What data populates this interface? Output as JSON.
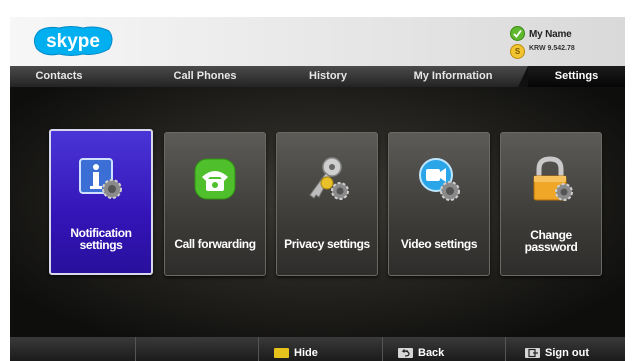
{
  "app": {
    "logo_text": "skype"
  },
  "user": {
    "name": "My Name",
    "credit": "KRW 9.542.78",
    "status_color": "#5fb82d"
  },
  "tabs": [
    {
      "label": "Contacts"
    },
    {
      "label": "Call Phones"
    },
    {
      "label": "History"
    },
    {
      "label": "My Information"
    },
    {
      "label": "Settings",
      "active": true
    }
  ],
  "settings": {
    "tiles": [
      {
        "label_line1": "Notification",
        "label_line2": "settings",
        "icon": "info-icon",
        "selected": true
      },
      {
        "label_line1": "Call forwarding",
        "label_line2": "",
        "icon": "phone-icon",
        "selected": false
      },
      {
        "label_line1": "Privacy settings",
        "label_line2": "",
        "icon": "keys-icon",
        "selected": false
      },
      {
        "label_line1": "Video settings",
        "label_line2": "",
        "icon": "video-camera-icon",
        "selected": false
      },
      {
        "label_line1": "Change",
        "label_line2": "password",
        "icon": "lock-icon",
        "selected": false
      }
    ]
  },
  "bottombar": {
    "hide_label": "Hide",
    "back_label": "Back",
    "signout_label": "Sign out",
    "hide_key_color": "#e8c21c"
  },
  "colors": {
    "accent": "#3314b7",
    "brand": "#00aff0"
  }
}
